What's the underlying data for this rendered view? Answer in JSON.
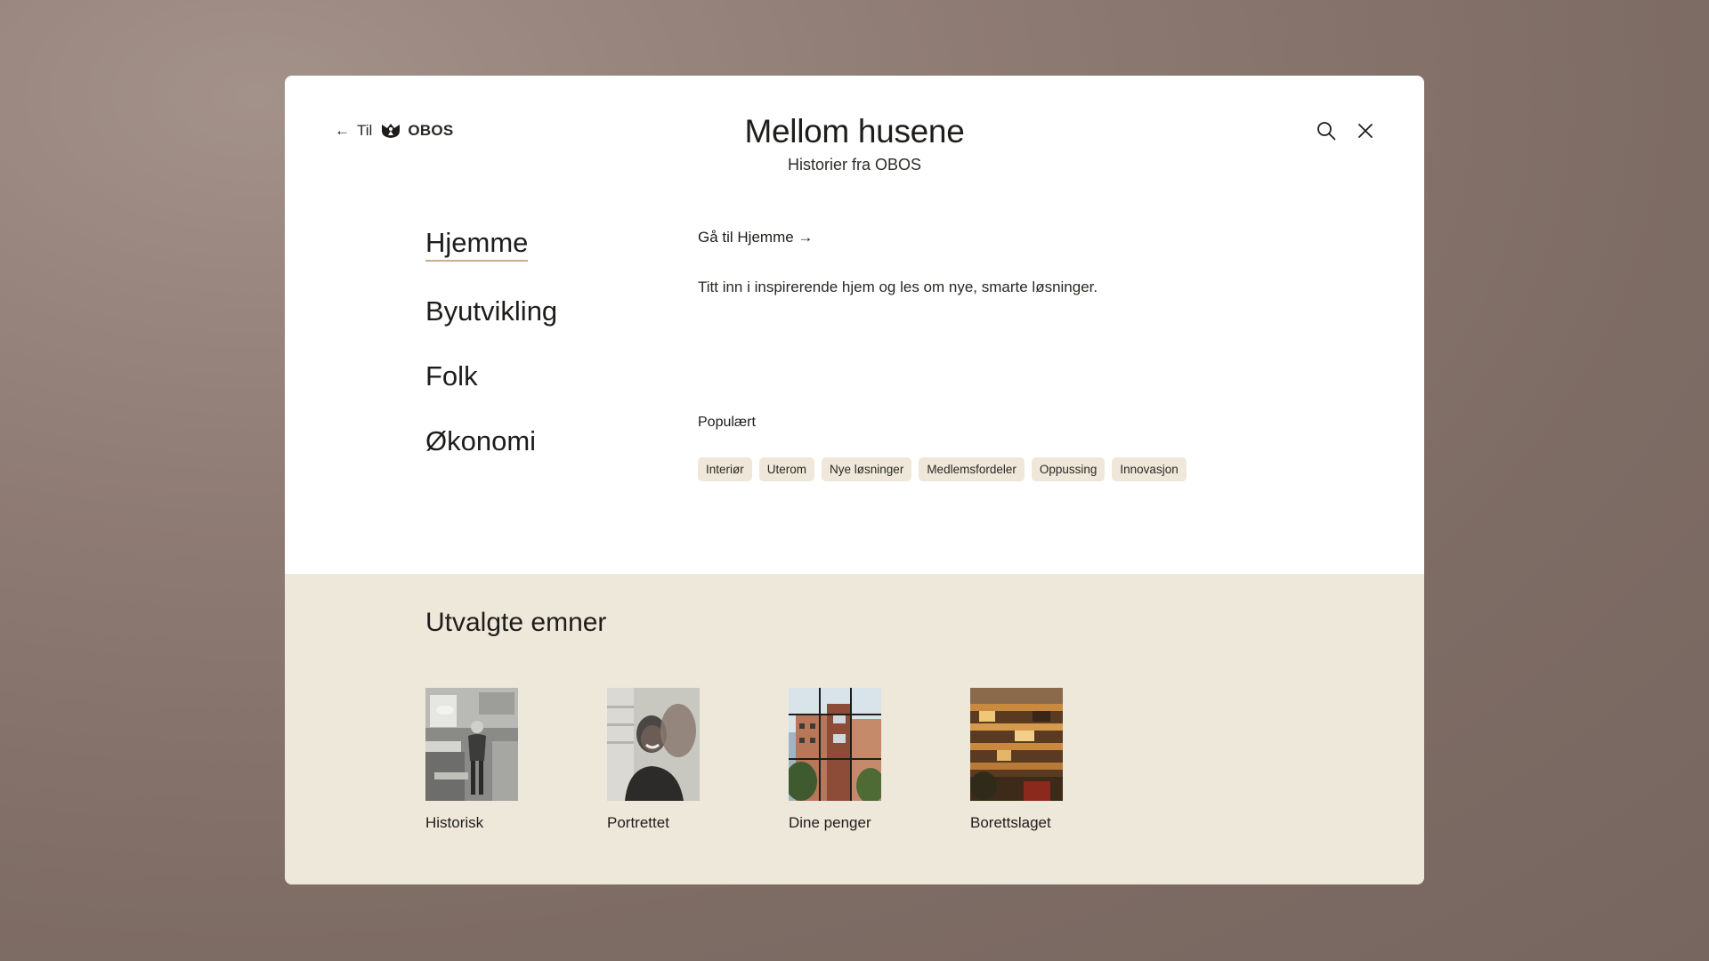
{
  "header": {
    "back_prefix": "Til",
    "brand": "OBOS",
    "title": "Mellom husene",
    "subtitle": "Historier fra OBOS"
  },
  "nav": {
    "items": [
      {
        "label": "Hjemme",
        "active": true
      },
      {
        "label": "Byutvikling",
        "active": false
      },
      {
        "label": "Folk",
        "active": false
      },
      {
        "label": "Økonomi",
        "active": false
      }
    ]
  },
  "content": {
    "goto_label": "Gå til Hjemme →",
    "description": "Titt inn i inspirerende hjem og les om nye, smarte løsninger.",
    "popular_label": "Populært",
    "tags": [
      "Interiør",
      "Uterom",
      "Nye løsninger",
      "Medlemsfordeler",
      "Oppussing",
      "Innovasjon"
    ]
  },
  "featured": {
    "title": "Utvalgte emner",
    "cards": [
      {
        "label": "Historisk"
      },
      {
        "label": "Portrettet"
      },
      {
        "label": "Dine penger"
      },
      {
        "label": "Borettslaget"
      }
    ]
  },
  "colors": {
    "tag_bg": "#efe8da",
    "bottom_bg": "#eee8db",
    "active_underline": "#c7ae8e"
  },
  "icons": [
    "arrow-left-icon",
    "obos-logo-icon",
    "search-icon",
    "close-icon"
  ]
}
